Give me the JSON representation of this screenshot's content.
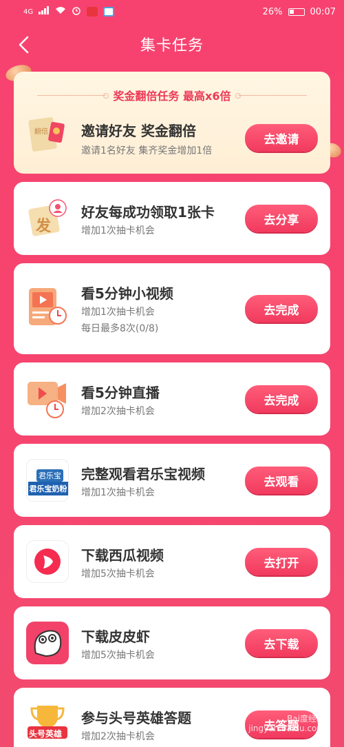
{
  "status": {
    "network": "4G",
    "battery": "26%",
    "time": "00:07"
  },
  "header": {
    "title": "集卡任务"
  },
  "promo": {
    "banner": "奖金翻倍任务 最高x6倍",
    "title": "邀请好友 奖金翻倍",
    "subtitle": "邀请1名好友 集齐奖金增加1倍",
    "button": "去邀请",
    "icon_text": "翻倍"
  },
  "tasks": [
    {
      "title": "好友每成功领取1张卡",
      "sub": "增加1次抽卡机会",
      "button": "去分享",
      "icon_text": "发"
    },
    {
      "title": "看5分钟小视频",
      "sub": "增加1次抽卡机会",
      "sub2": "每日最多8次(0/8)",
      "button": "去完成"
    },
    {
      "title": "看5分钟直播",
      "sub": "增加2次抽卡机会",
      "button": "去完成"
    },
    {
      "title": "完整观看君乐宝视频",
      "sub": "增加1次抽卡机会",
      "button": "去观看",
      "icon_text": "君乐宝奶粉",
      "icon_text2": "君乐宝"
    },
    {
      "title": "下载西瓜视频",
      "sub": "增加5次抽卡机会",
      "button": "去打开"
    },
    {
      "title": "下载皮皮虾",
      "sub": "增加5次抽卡机会",
      "button": "去下载"
    },
    {
      "title": "参与头号英雄答题",
      "sub": "增加2次抽卡机会",
      "button": "去答题",
      "icon_text": "头号英雄"
    }
  ],
  "watermark": "Bai度经验\njingyan.baidu.com",
  "colors": {
    "background": "#f6456f",
    "button": "#f13a5e",
    "promo_bg": "#fff6e3"
  }
}
